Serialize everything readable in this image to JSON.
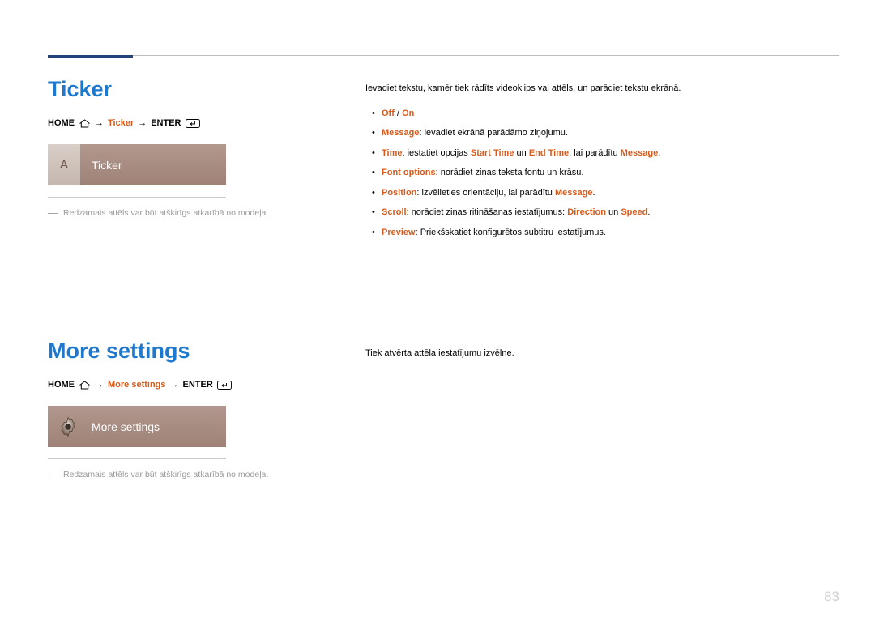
{
  "pageNumber": "83",
  "section1": {
    "heading": "Ticker",
    "breadcrumb": {
      "home": "HOME",
      "arrow": "→",
      "mid": "Ticker",
      "enter": "ENTER"
    },
    "tile": {
      "badge": "A",
      "label": "Ticker"
    },
    "note": "Redzamais attēls var būt atšķirīgs atkarībā no modeļa."
  },
  "right1": {
    "intro": "Ievadiet tekstu, kamēr tiek rādīts videoklips vai attēls, un parādiet tekstu ekrānā.",
    "bullets": {
      "b0": {
        "off": "Off",
        "slash": " / ",
        "on": "On"
      },
      "b1": {
        "label": "Message",
        "text": ": ievadiet ekrānā parādāmo ziņojumu."
      },
      "b2": {
        "label": "Time",
        "t1": ": iestatiet opcijas ",
        "start": "Start Time",
        "t2": " un ",
        "end": "End Time",
        "t3": ", lai parādītu ",
        "msg": "Message",
        "t4": "."
      },
      "b3": {
        "label": "Font options",
        "text": ": norādiet ziņas teksta fontu un krāsu."
      },
      "b4": {
        "label": "Position",
        "t1": ": izvēlieties orientāciju, lai parādītu ",
        "msg": "Message",
        "t2": "."
      },
      "b5": {
        "label": "Scroll",
        "t1": ": norādiet ziņas ritināšanas iestatījumus: ",
        "dir": "Direction",
        "t2": " un ",
        "spd": "Speed",
        "t3": "."
      },
      "b6": {
        "label": "Preview",
        "text": ": Priekšskatiet konfigurētos subtitru iestatījumus."
      }
    }
  },
  "section2": {
    "heading": "More settings",
    "breadcrumb": {
      "home": "HOME",
      "arrow": "→",
      "mid": "More settings",
      "enter": "ENTER"
    },
    "tile": {
      "label": "More settings"
    },
    "note": "Redzamais attēls var būt atšķirīgs atkarībā no modeļa."
  },
  "right2": {
    "intro": "Tiek atvērta attēla iestatījumu izvēlne."
  }
}
